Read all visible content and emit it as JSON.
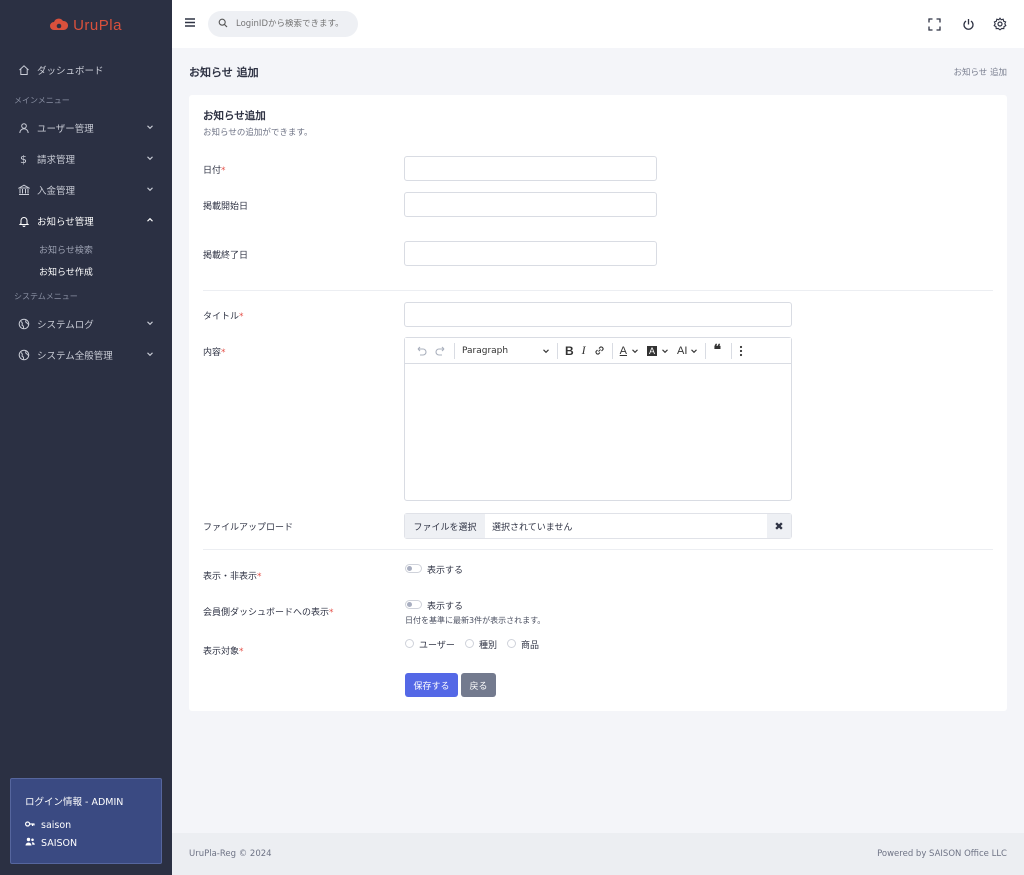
{
  "app": {
    "logo_text": "UruPla",
    "brand_color": "#d9503c",
    "accent_color": "#5468e6"
  },
  "sidebar": {
    "dashboard": "ダッシュボード",
    "main_menu_label": "メインメニュー",
    "user_mgmt": "ユーザー管理",
    "billing_mgmt": "請求管理",
    "payment_mgmt": "入金管理",
    "notice_mgmt": "お知らせ管理",
    "notice_search": "お知らせ検索",
    "notice_create": "お知らせ作成",
    "system_menu_label": "システムメニュー",
    "system_log": "システムログ",
    "system_general": "システム全般管理",
    "login_title": "ログイン情報 - ADMIN",
    "login_user": "saison",
    "login_company": "SAISON"
  },
  "header": {
    "search_placeholder": "LoginIDから検索できます。"
  },
  "page": {
    "title": "お知らせ 追加",
    "breadcrumb": "お知らせ 追加"
  },
  "form": {
    "title": "お知らせ追加",
    "subtitle": "お知らせの追加ができます。",
    "date_label": "日付",
    "date_value": "",
    "start_label": "掲載開始日",
    "start_value": "",
    "end_label": "掲載終了日",
    "end_value": "",
    "title_label": "タイトル",
    "title_value": "",
    "content_label": "内容",
    "editor_paragraph": "Paragraph",
    "file_label": "ファイルアップロード",
    "file_button": "ファイルを選択",
    "file_status": "選択されていません",
    "file_clear": "✖",
    "visibility_label": "表示・非表示",
    "visibility_option": "表示する",
    "dashboard_label": "会員側ダッシュボードへの表示",
    "dashboard_option": "表示する",
    "dashboard_hint": "日付を基準に最新3件が表示されます。",
    "target_label": "表示対象",
    "target_user": "ユーザー",
    "target_type": "種別",
    "target_product": "商品",
    "required_mark": "*",
    "save_button": "保存する",
    "back_button": "戻る"
  },
  "footer": {
    "left": "UruPla-Reg © 2024",
    "right": "Powered by SAISON Office LLC"
  }
}
